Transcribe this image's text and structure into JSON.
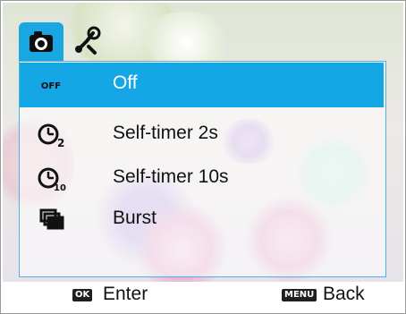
{
  "menu": {
    "tabs": [
      {
        "icon": "camera-icon",
        "selected": true
      },
      {
        "icon": "settings-icon",
        "selected": false
      }
    ],
    "items": [
      {
        "label": "Off",
        "icon": "off-icon",
        "icon_text": "OFF",
        "selected": true
      },
      {
        "label": "Self-timer 2s",
        "icon": "self-timer-2s-icon",
        "selected": false
      },
      {
        "label": "Self-timer 10s",
        "icon": "self-timer-10s-icon",
        "selected": false
      },
      {
        "label": "Burst",
        "icon": "burst-icon",
        "selected": false
      }
    ]
  },
  "footer": {
    "enter_key": "OK",
    "enter_label": "Enter",
    "back_key": "MENU",
    "back_label": "Back"
  },
  "colors": {
    "accent": "#15a6e6",
    "panel_border": "#4fb3df"
  }
}
